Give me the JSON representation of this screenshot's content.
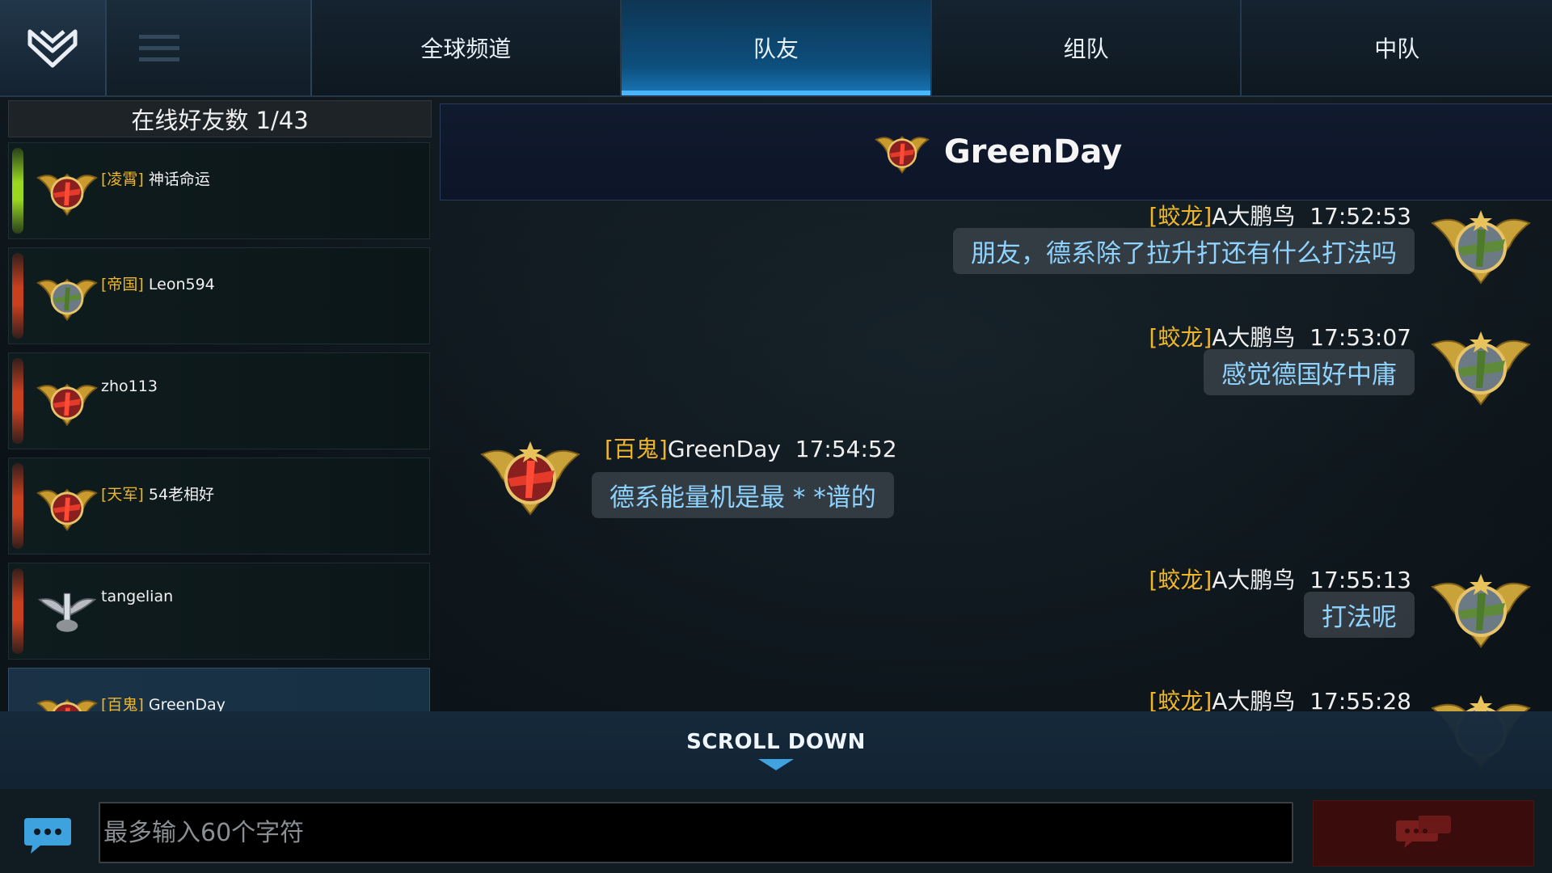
{
  "tabs": [
    {
      "label": "全球频道",
      "active": false
    },
    {
      "label": "队友",
      "active": true
    },
    {
      "label": "组队",
      "active": false
    },
    {
      "label": "中队",
      "active": false
    }
  ],
  "friends_panel": {
    "header": "在线好友数 1/43",
    "friends": [
      {
        "tag": "[凌霄]",
        "name": "神话命运",
        "online": true,
        "avatar_icon": "red-plane-badge-icon"
      },
      {
        "tag": "[帝国]",
        "name": "Leon594",
        "online": false,
        "avatar_icon": "green-plane-badge-icon"
      },
      {
        "tag": "",
        "name": "zho113",
        "online": false,
        "avatar_icon": "red-plane-badge-icon"
      },
      {
        "tag": "[天军]",
        "name": "54老相好",
        "online": false,
        "avatar_icon": "red-plane-badge-icon"
      },
      {
        "tag": "",
        "name": "tangelian",
        "online": false,
        "avatar_icon": "wings-emblem-icon"
      },
      {
        "tag": "[百鬼]",
        "name": "GreenDay",
        "online": false,
        "selected": true,
        "avatar_icon": "red-plane-badge-icon"
      }
    ]
  },
  "chat": {
    "title": "GreenDay",
    "messages": [
      {
        "tag": "[蛟龙]",
        "sender": "A大鹏鸟",
        "time": "17:52:53",
        "text": "朋友，德系除了拉升打还有什么打法吗",
        "side": "right"
      },
      {
        "tag": "[蛟龙]",
        "sender": "A大鹏鸟",
        "time": "17:53:07",
        "text": "感觉德国好中庸",
        "side": "right"
      },
      {
        "tag": "[百鬼]",
        "sender": "GreenDay",
        "time": "17:54:52",
        "text": "德系能量机是最 * *谱的",
        "side": "left"
      },
      {
        "tag": "[蛟龙]",
        "sender": "A大鹏鸟",
        "time": "17:55:13",
        "text": "打法呢",
        "side": "right"
      },
      {
        "tag": "[蛟龙]",
        "sender": "A大鹏鸟",
        "time": "17:55:28",
        "text": "",
        "side": "right"
      }
    ]
  },
  "scroll_down": {
    "label": "SCROLL DOWN"
  },
  "input": {
    "placeholder": "最多输入60个字符",
    "value": ""
  },
  "colors": {
    "tag": "#f0b62a",
    "bubble_text": "#8fd3ff",
    "active_tab": "#1a78b9",
    "online": "#9ad81e",
    "offline": "#c9401e"
  }
}
